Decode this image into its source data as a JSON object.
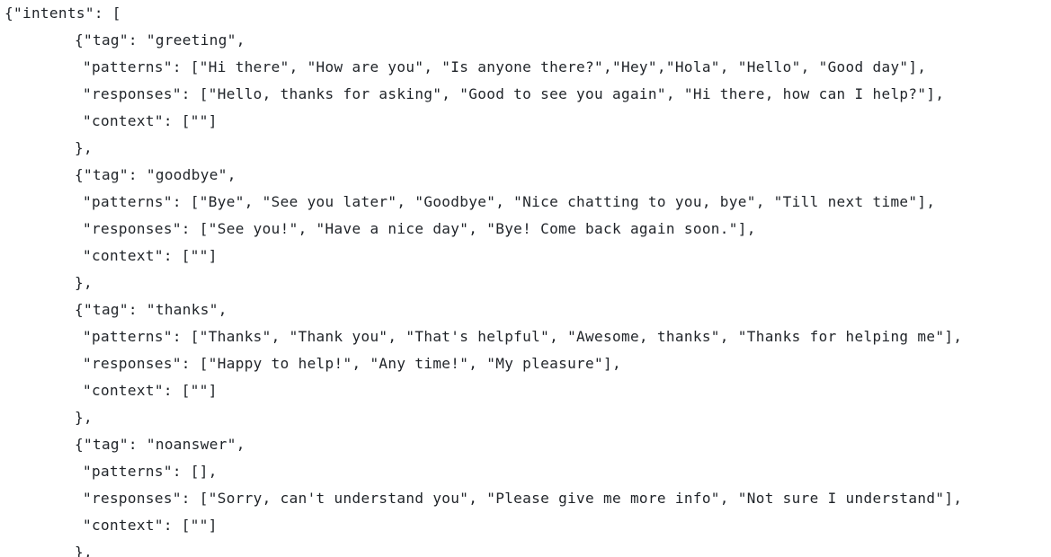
{
  "code_lines": [
    "{\"intents\": [",
    "{\"tag\": \"greeting\",",
    "\"patterns\": [\"Hi there\", \"How are you\", \"Is anyone there?\",\"Hey\",\"Hola\", \"Hello\", \"Good day\"],",
    "\"responses\": [\"Hello, thanks for asking\", \"Good to see you again\", \"Hi there, how can I help?\"],",
    "\"context\": [\"\"]",
    "},",
    "{\"tag\": \"goodbye\",",
    "\"patterns\": [\"Bye\", \"See you later\", \"Goodbye\", \"Nice chatting to you, bye\", \"Till next time\"],",
    "\"responses\": [\"See you!\", \"Have a nice day\", \"Bye! Come back again soon.\"],",
    "\"context\": [\"\"]",
    "},",
    "{\"tag\": \"thanks\",",
    "\"patterns\": [\"Thanks\", \"Thank you\", \"That's helpful\", \"Awesome, thanks\", \"Thanks for helping me\"],",
    "\"responses\": [\"Happy to help!\", \"Any time!\", \"My pleasure\"],",
    "\"context\": [\"\"]",
    "},",
    "{\"tag\": \"noanswer\",",
    "\"patterns\": [],",
    "\"responses\": [\"Sorry, can't understand you\", \"Please give me more info\", \"Not sure I understand\"],",
    "\"context\": [\"\"]",
    "},"
  ]
}
